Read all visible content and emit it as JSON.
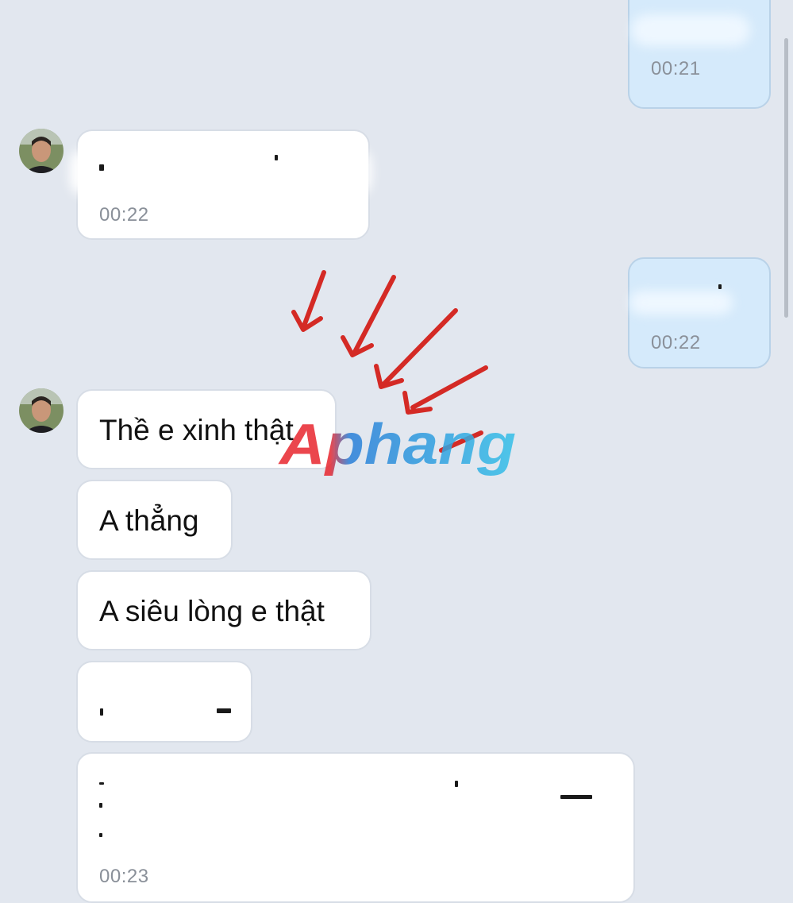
{
  "messages": [
    {
      "direction": "outgoing",
      "time": "00:21"
    },
    {
      "direction": "incoming",
      "time": "00:22"
    },
    {
      "direction": "outgoing",
      "time": "00:22"
    },
    {
      "direction": "incoming",
      "text": "Thề e xinh thật"
    },
    {
      "direction": "incoming",
      "text": "A thẳng"
    },
    {
      "direction": "incoming",
      "text": "A siêu lòng e thật"
    },
    {
      "direction": "incoming"
    },
    {
      "direction": "incoming",
      "time": "00:23"
    }
  ],
  "watermark": {
    "text": "Aphang",
    "colors": [
      "#e8262e",
      "#2a7fd8",
      "#35c0e8"
    ]
  },
  "annotation": {
    "arrow_color": "#d42a25",
    "arrow_count": 5
  },
  "colors": {
    "background": "#e2e7ef",
    "incoming_bubble": "#ffffff",
    "outgoing_bubble": "#d5eafb",
    "timestamp": "#8a9099"
  },
  "icons": {
    "avatar": "user-avatar-photo"
  }
}
